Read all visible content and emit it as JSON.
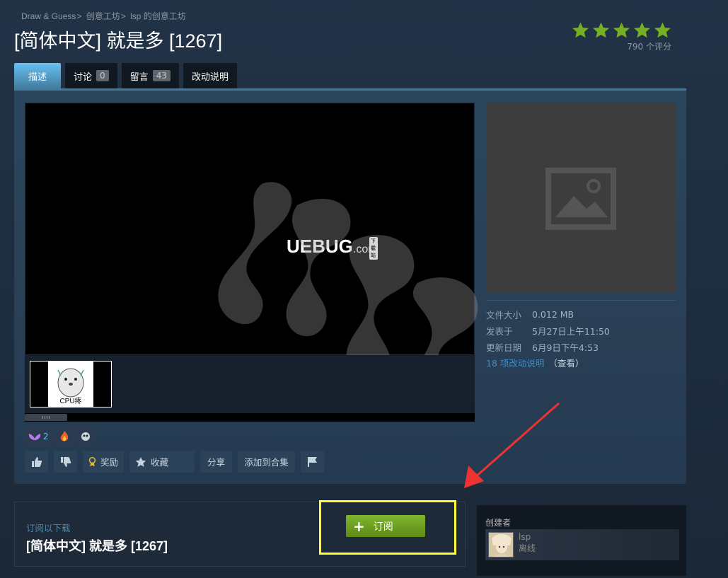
{
  "breadcrumb": {
    "items": [
      "Draw & Guess",
      "创意工坊",
      "lsp 的创意工坊"
    ]
  },
  "title": "[简体中文] 就是多 [1267]",
  "rating": {
    "stars": 5,
    "count_text": "790 个评分",
    "star_color": "#75b022"
  },
  "tabs": [
    {
      "label": "描述",
      "count": null
    },
    {
      "label": "讨论",
      "count": "0"
    },
    {
      "label": "留言",
      "count": "43"
    },
    {
      "label": "改动说明",
      "count": null
    }
  ],
  "viewer": {
    "logo_main": "UEBUG",
    "logo_suffix": ".com",
    "logo_tag": "下载站",
    "thumbnail_label": "CPU疼"
  },
  "details": {
    "rows": [
      {
        "key": "文件大小",
        "value": "0.012 MB"
      },
      {
        "key": "发表于",
        "value": "5月27日上午11:50"
      },
      {
        "key": "更新日期",
        "value": "6月9日下午4:53"
      }
    ],
    "changelog_link": "18 项改动说明",
    "changelog_view": "（查看）"
  },
  "awards": {
    "first_count": "2"
  },
  "actions": {
    "award_label": "奖励",
    "favorite_label": "收藏",
    "share_label": "分享",
    "add_collection_label": "添加到合集"
  },
  "subscribe": {
    "label": "订阅以下载",
    "title": "[简体中文] 就是多 [1267]",
    "button_label": "订阅",
    "button_color": "#75b022",
    "highlight_color": "#ffff33"
  },
  "creator": {
    "heading": "创建者",
    "name": "lsp",
    "status": "离线"
  }
}
